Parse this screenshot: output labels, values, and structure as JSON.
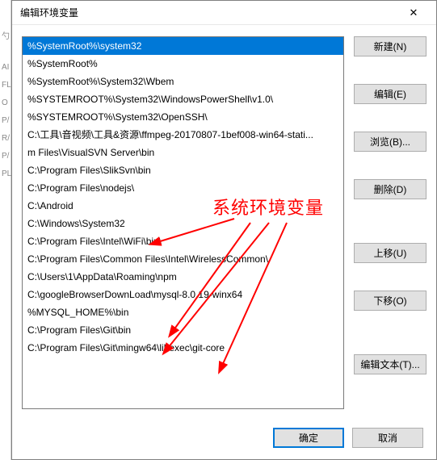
{
  "dialog": {
    "title": "编辑环境变量",
    "close_glyph": "✕"
  },
  "list": {
    "items": [
      "%SystemRoot%\\system32",
      "%SystemRoot%",
      "%SystemRoot%\\System32\\Wbem",
      "%SYSTEMROOT%\\System32\\WindowsPowerShell\\v1.0\\",
      "%SYSTEMROOT%\\System32\\OpenSSH\\",
      "C:\\工具\\音视频\\工具&资源\\ffmpeg-20170807-1bef008-win64-stati...",
      "m Files\\VisualSVN Server\\bin",
      "C:\\Program Files\\SlikSvn\\bin",
      "C:\\Program Files\\nodejs\\",
      "C:\\Android",
      "C:\\Windows\\System32",
      "C:\\Program Files\\Intel\\WiFi\\bin\\",
      "C:\\Program Files\\Common Files\\Intel\\WirelessCommon\\",
      "C:\\Users\\1\\AppData\\Roaming\\npm",
      "C:\\googleBrowserDownLoad\\mysql-8.0.19-winx64",
      "%MYSQL_HOME%\\bin",
      "C:\\Program Files\\Git\\bin",
      "C:\\Program Files\\Git\\mingw64\\libexec\\git-core"
    ],
    "selected_index": 0
  },
  "buttons": {
    "new": "新建(N)",
    "edit": "编辑(E)",
    "browse": "浏览(B)...",
    "delete": "删除(D)",
    "move_up": "上移(U)",
    "move_down": "下移(O)",
    "edit_text": "编辑文本(T)...",
    "ok": "确定",
    "cancel": "取消"
  },
  "annotation": {
    "text": "系统环境变量"
  },
  "bg_ghost_chars": [
    "勺",
    "AI",
    "FL",
    "O",
    "P/",
    "R/",
    "P/",
    "PL"
  ]
}
